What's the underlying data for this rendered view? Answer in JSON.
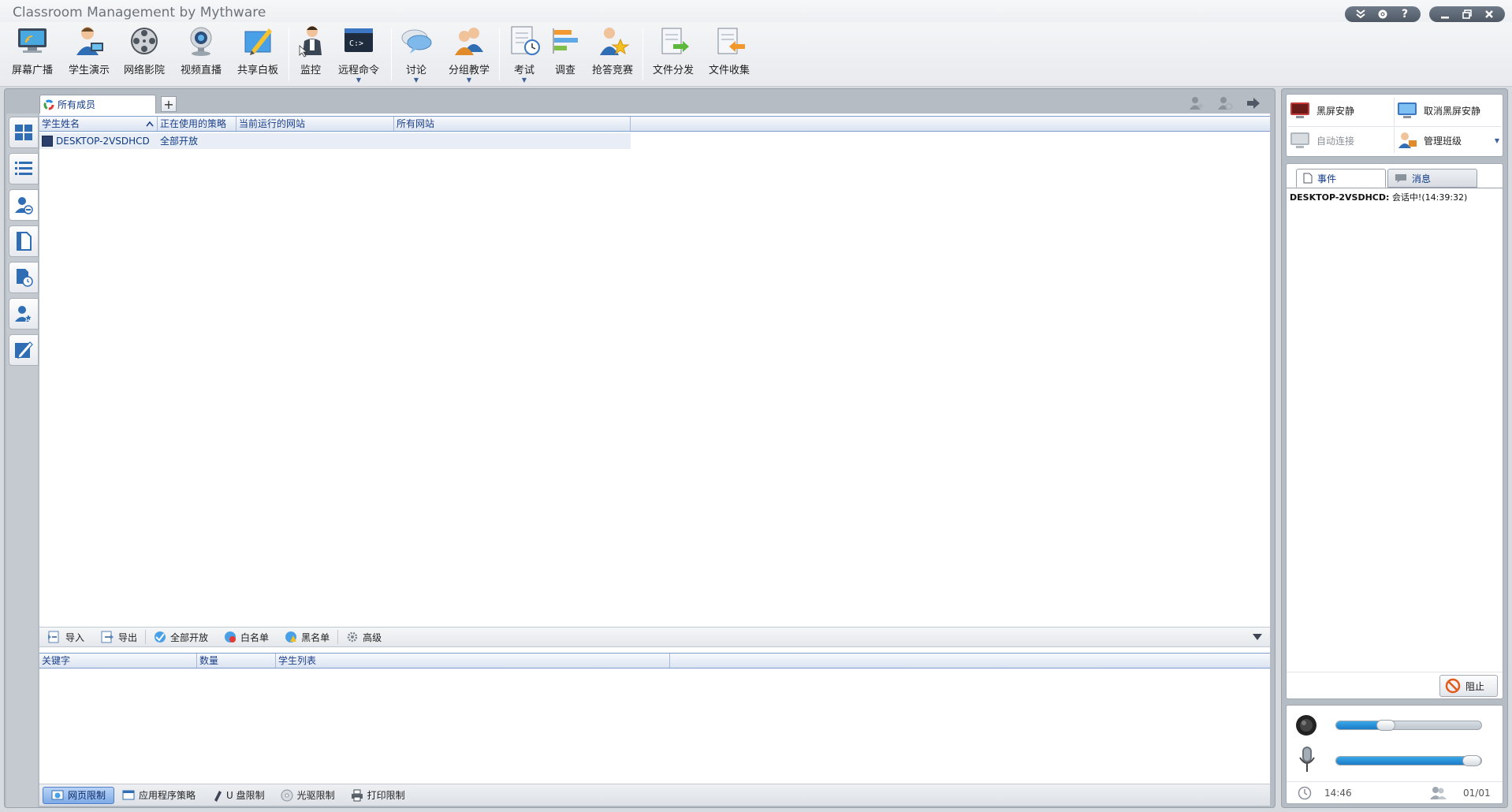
{
  "window": {
    "title": "Classroom Management by Mythware"
  },
  "toolbar": {
    "items": [
      {
        "label": "屏幕广播",
        "icon": "broadcast-screen-icon",
        "caret": false
      },
      {
        "label": "学生演示",
        "icon": "student-demo-icon",
        "caret": false
      },
      {
        "label": "网络影院",
        "icon": "film-reel-icon",
        "caret": false
      },
      {
        "label": "视频直播",
        "icon": "webcam-icon",
        "caret": false
      },
      {
        "label": "共享白板",
        "icon": "whiteboard-pen-icon",
        "caret": false
      },
      {
        "label": "监控",
        "icon": "monitor-person-icon",
        "caret": false
      },
      {
        "label": "远程命令",
        "icon": "command-prompt-icon",
        "caret": true
      },
      {
        "label": "讨论",
        "icon": "chat-bubble-icon",
        "caret": true
      },
      {
        "label": "分组教学",
        "icon": "group-teaching-icon",
        "caret": true
      },
      {
        "label": "考试",
        "icon": "exam-clock-icon",
        "caret": true
      },
      {
        "label": "调查",
        "icon": "survey-bars-icon",
        "caret": false
      },
      {
        "label": "抢答竞赛",
        "icon": "quiz-star-icon",
        "caret": false
      },
      {
        "label": "文件分发",
        "icon": "file-send-icon",
        "caret": false
      },
      {
        "label": "文件收集",
        "icon": "file-collect-icon",
        "caret": false
      }
    ]
  },
  "tabs": {
    "active": "所有成员",
    "add_label": "+"
  },
  "student_table": {
    "columns": [
      "学生姓名",
      "正在使用的策略",
      "当前运行的网站",
      "所有网站"
    ],
    "rows": [
      {
        "name": "DESKTOP-2VSDHCD",
        "policy": "全部开放",
        "running_site": "",
        "all_sites": ""
      }
    ]
  },
  "sub_toolbar": {
    "import": "导入",
    "export": "导出",
    "allow_all": "全部开放",
    "whitelist": "白名单",
    "blacklist": "黑名单",
    "advanced": "高级"
  },
  "keyword_table": {
    "columns": [
      "关键字",
      "数量",
      "学生列表"
    ]
  },
  "bottom_tabs": [
    {
      "label": "网页限制",
      "icon": "web-limit-icon",
      "active": true
    },
    {
      "label": "应用程序策略",
      "icon": "app-policy-icon",
      "active": false
    },
    {
      "label": "U 盘限制",
      "icon": "usb-icon",
      "active": false
    },
    {
      "label": "光驱限制",
      "icon": "cd-drive-icon",
      "active": false
    },
    {
      "label": "打印限制",
      "icon": "printer-icon",
      "active": false
    }
  ],
  "right_panel": {
    "black_screen": "黑屏安静",
    "cancel_black_screen": "取消黑屏安静",
    "auto_connect": "自动连接",
    "manage_class": "管理班级",
    "tab_events": "事件",
    "tab_messages": "消息",
    "event_log": [
      {
        "source": "DESKTOP-2VSDHCD:",
        "text": " 会话中!(14:39:32)"
      }
    ],
    "block_label": "阻止",
    "speaker_volume": 0.34,
    "mic_volume": 0.95,
    "time": "14:46",
    "online_count": "01/01"
  },
  "colors": {
    "accent": "#1b7cc8",
    "header_text": "#1c3f8a",
    "panel_bg": "#b6bcc4"
  }
}
